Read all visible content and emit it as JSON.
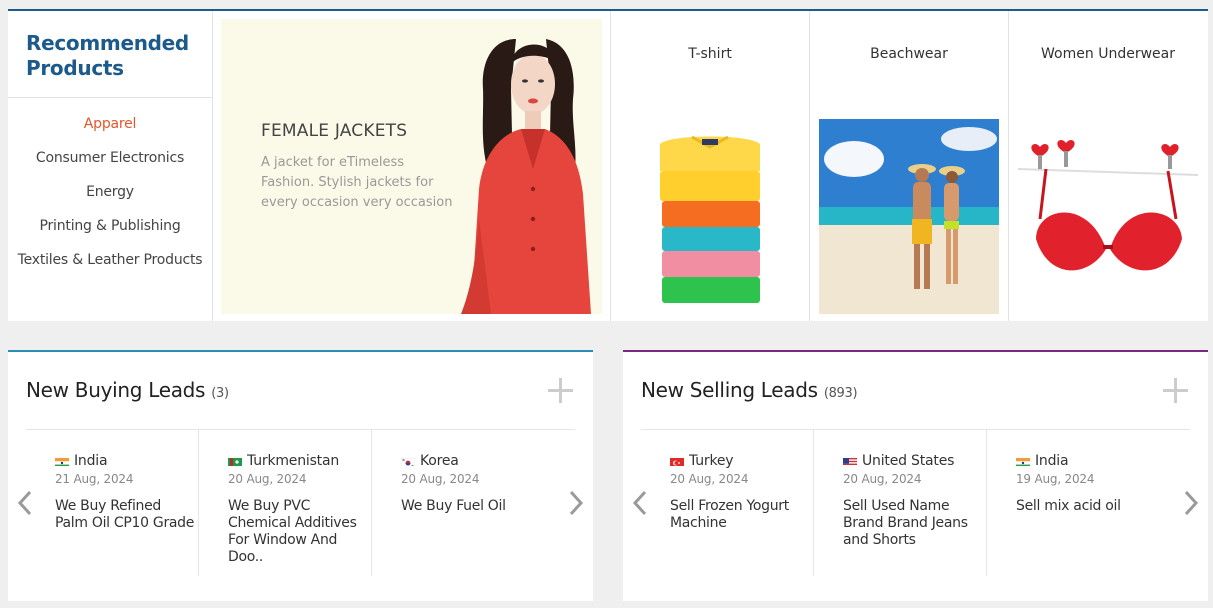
{
  "recommended": {
    "title": "Recommended Products",
    "categories": [
      {
        "label": "Apparel",
        "active": true
      },
      {
        "label": "Consumer Electronics"
      },
      {
        "label": "Energy"
      },
      {
        "label": "Printing & Publishing"
      },
      {
        "label": "Textiles & Leather Products"
      }
    ],
    "banner": {
      "title": "FEMALE JACKETS",
      "description": "A jacket for eTimeless Fashion. Stylish jackets for every occasion very occasion"
    },
    "products": [
      {
        "name": "T-shirt"
      },
      {
        "name": "Beachwear"
      },
      {
        "name": "Women Underwear"
      }
    ]
  },
  "buying": {
    "title": "New Buying Leads",
    "count": "(3)",
    "leads": [
      {
        "country": "India",
        "date": "21 Aug, 2024",
        "title": "We Buy Refined Palm Oil CP10 Grade"
      },
      {
        "country": "Turkmenistan",
        "date": "20 Aug, 2024",
        "title": "We Buy PVC Chemical Additives For Window And Doo.."
      },
      {
        "country": "Korea",
        "date": "20 Aug, 2024",
        "title": "We Buy Fuel Oil"
      }
    ]
  },
  "selling": {
    "title": "New Selling Leads",
    "count": "(893)",
    "leads": [
      {
        "country": "Turkey",
        "date": "20 Aug, 2024",
        "title": "Sell Frozen Yogurt Machine"
      },
      {
        "country": "United States",
        "date": "20 Aug, 2024",
        "title": "Sell Used Name Brand Brand Jeans and Shorts"
      },
      {
        "country": "India",
        "date": "19 Aug, 2024",
        "title": "Sell mix acid oil"
      }
    ]
  },
  "colors": {
    "brand_blue": "#1b5a8a",
    "active_category": "#e4572e",
    "buying_accent": "#2a8db4",
    "selling_accent": "#7a2a7e"
  }
}
